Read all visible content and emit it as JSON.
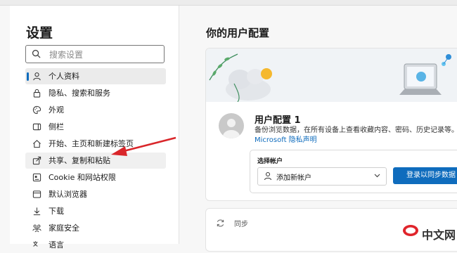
{
  "sidebar": {
    "title": "设置",
    "search_placeholder": "搜索设置",
    "items": [
      {
        "label": "个人资料",
        "icon": "person-icon"
      },
      {
        "label": "隐私、搜索和服务",
        "icon": "lock-icon"
      },
      {
        "label": "外观",
        "icon": "palette-icon"
      },
      {
        "label": "侧栏",
        "icon": "sidebar-icon"
      },
      {
        "label": "开始、主页和新建标签页",
        "icon": "home-icon"
      },
      {
        "label": "共享、复制和粘贴",
        "icon": "share-icon"
      },
      {
        "label": "Cookie 和网站权限",
        "icon": "site-permissions-icon"
      },
      {
        "label": "默认浏览器",
        "icon": "browser-icon"
      },
      {
        "label": "下载",
        "icon": "download-icon"
      },
      {
        "label": "家庭安全",
        "icon": "family-icon"
      },
      {
        "label": "语言",
        "icon": "language-icon"
      }
    ]
  },
  "main": {
    "title": "你的用户配置",
    "profile": {
      "name": "用户配置 1",
      "description": "备份浏览数据，在所有设备上查看收藏内容、密码、历史记录等。",
      "privacy_link": "Microsoft 隐私声明"
    },
    "account": {
      "label": "选择帐户",
      "select_value": "添加新帐户",
      "sync_button": "登录以同步数据"
    },
    "sync_section": {
      "label": "同步"
    }
  },
  "watermark": {
    "text": "中文网"
  },
  "colors": {
    "accent": "#0f6cbd",
    "annotation_arrow": "#d9262a"
  }
}
